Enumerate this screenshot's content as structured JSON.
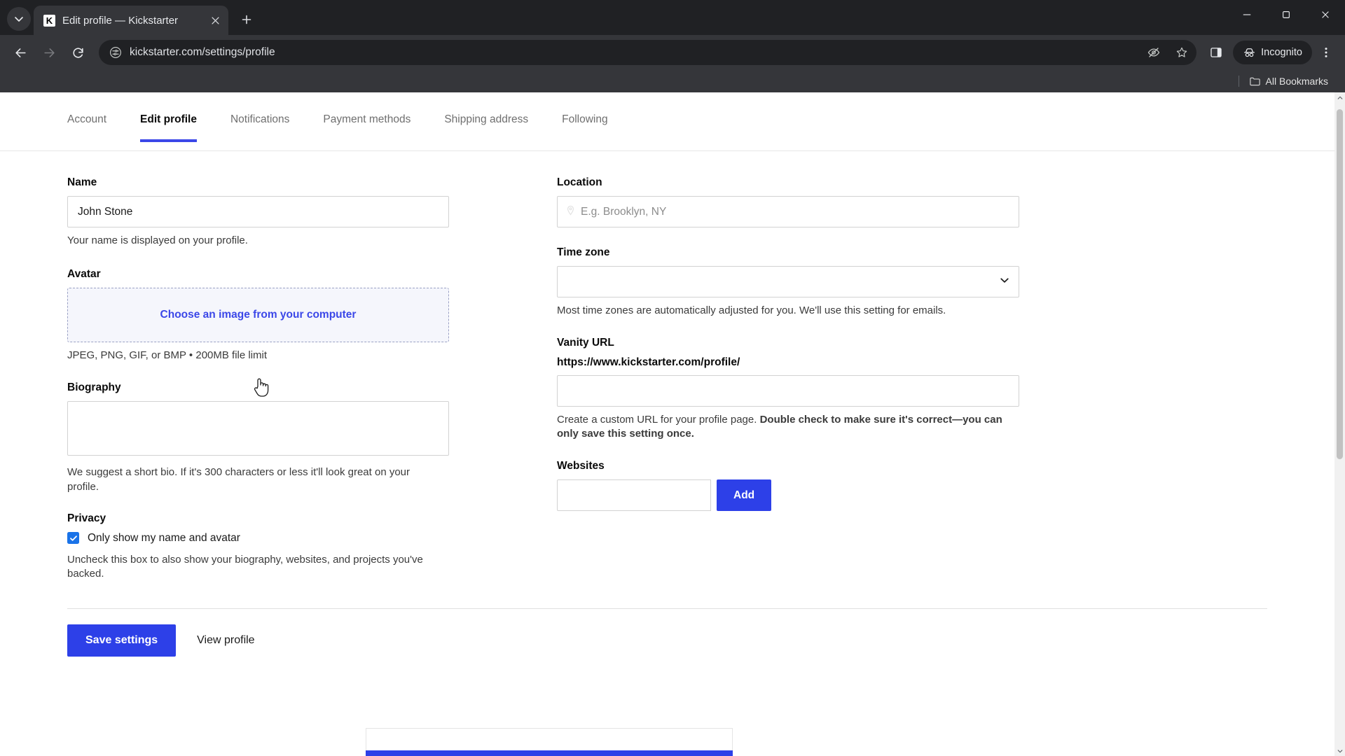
{
  "browser": {
    "tab": {
      "title": "Edit profile — Kickstarter",
      "favicon_icon": "kickstarter-favicon",
      "close_icon": "close-icon"
    },
    "tab_search_icon": "chevron-down-icon",
    "new_tab_icon": "plus-icon",
    "window_controls": {
      "minimize_icon": "minimize-icon",
      "maximize_icon": "maximize-icon",
      "close_icon": "window-close-icon"
    },
    "nav": {
      "back_icon": "back-arrow-icon",
      "forward_icon": "forward-arrow-icon",
      "reload_icon": "reload-icon"
    },
    "omnibox": {
      "url": "kickstarter.com/settings/profile",
      "site_info_icon": "page-info-icon",
      "tracking_icon": "eye-slash-icon",
      "bookmark_icon": "star-icon"
    },
    "side_panel_icon": "side-panel-icon",
    "incognito": {
      "label": "Incognito",
      "icon": "incognito-icon"
    },
    "menu_icon": "three-dot-menu-icon",
    "bookmarks": {
      "label": "All Bookmarks",
      "icon": "folder-icon"
    }
  },
  "page": {
    "tabs": [
      {
        "label": "Account",
        "active": false
      },
      {
        "label": "Edit profile",
        "active": true
      },
      {
        "label": "Notifications",
        "active": false
      },
      {
        "label": "Payment methods",
        "active": false
      },
      {
        "label": "Shipping address",
        "active": false
      },
      {
        "label": "Following",
        "active": false
      }
    ],
    "left": {
      "name": {
        "label": "Name",
        "value": "John Stone",
        "help": "Your name is displayed on your profile."
      },
      "avatar": {
        "label": "Avatar",
        "cta": "Choose an image from your computer",
        "help": "JPEG, PNG, GIF, or BMP • 200MB file limit"
      },
      "biography": {
        "label": "Biography",
        "value": "",
        "help": "We suggest a short bio. If it's 300 characters or less it'll look great on your profile."
      },
      "privacy": {
        "label": "Privacy",
        "checkbox_label": "Only show my name and avatar",
        "checked": true,
        "help": "Uncheck this box to also show your biography, websites, and projects you've backed."
      }
    },
    "right": {
      "location": {
        "label": "Location",
        "value": "",
        "placeholder": "E.g. Brooklyn, NY",
        "icon": "map-pin-icon"
      },
      "timezone": {
        "label": "Time zone",
        "value": "",
        "help": "Most time zones are automatically adjusted for you. We'll use this setting for emails.",
        "chevron_icon": "chevron-down-icon"
      },
      "vanity_url": {
        "label": "Vanity URL",
        "prefix": "https://www.kickstarter.com/profile/",
        "value": "",
        "help_plain": "Create a custom URL for your profile page. ",
        "help_bold": "Double check to make sure it's correct—you can only save this setting once."
      },
      "websites": {
        "label": "Websites",
        "value": "",
        "add_label": "Add"
      }
    },
    "footer": {
      "save_label": "Save settings",
      "view_profile_label": "View profile"
    }
  },
  "colors": {
    "accent": "#2d40e8",
    "tab_indicator": "#3b47e8",
    "checkbox": "#1a73e8",
    "dropzone_bg": "#f5f6fc"
  }
}
